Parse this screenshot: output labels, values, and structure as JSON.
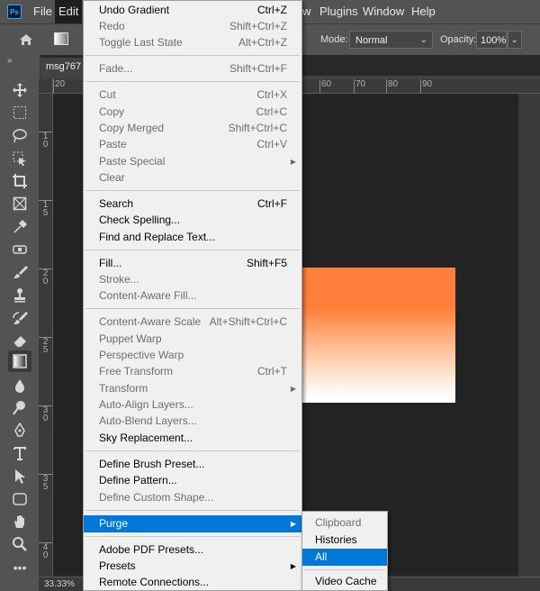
{
  "app": {
    "logo_text": "Ps"
  },
  "menubar": {
    "file": "File",
    "edit": "Edit",
    "view_partial": "w",
    "plugins": "Plugins",
    "window": "Window",
    "help": "Help"
  },
  "options": {
    "mode_label": "Mode:",
    "mode_value": "Normal",
    "opacity_label": "Opacity:",
    "opacity_value": "100%"
  },
  "document": {
    "tab_title": "msg767",
    "zoom": "33.33%",
    "ruler_h": [
      "20",
      "60",
      "70",
      "80",
      "90"
    ],
    "ruler_v": [
      "1",
      "0",
      "1",
      "5",
      "2",
      "0",
      "2",
      "5",
      "3",
      "0",
      "3",
      "5",
      "4",
      "0"
    ],
    "gradient_colors": {
      "top": "#ff7f3a",
      "bottom": "#ffffff"
    }
  },
  "edit_menu": {
    "undo": {
      "label": "Undo Gradient",
      "shortcut": "Ctrl+Z"
    },
    "redo": {
      "label": "Redo",
      "shortcut": "Shift+Ctrl+Z"
    },
    "toggle_last_state": {
      "label": "Toggle Last State",
      "shortcut": "Alt+Ctrl+Z"
    },
    "fade": {
      "label": "Fade...",
      "shortcut": "Shift+Ctrl+F"
    },
    "cut": {
      "label": "Cut",
      "shortcut": "Ctrl+X"
    },
    "copy": {
      "label": "Copy",
      "shortcut": "Ctrl+C"
    },
    "copy_merged": {
      "label": "Copy Merged",
      "shortcut": "Shift+Ctrl+C"
    },
    "paste": {
      "label": "Paste",
      "shortcut": "Ctrl+V"
    },
    "paste_special": {
      "label": "Paste Special"
    },
    "clear": {
      "label": "Clear"
    },
    "search": {
      "label": "Search",
      "shortcut": "Ctrl+F"
    },
    "check_spelling": {
      "label": "Check Spelling..."
    },
    "find_replace": {
      "label": "Find and Replace Text..."
    },
    "fill": {
      "label": "Fill...",
      "shortcut": "Shift+F5"
    },
    "stroke": {
      "label": "Stroke..."
    },
    "content_aware_fill": {
      "label": "Content-Aware Fill..."
    },
    "content_aware_scale": {
      "label": "Content-Aware Scale",
      "shortcut": "Alt+Shift+Ctrl+C"
    },
    "puppet_warp": {
      "label": "Puppet Warp"
    },
    "perspective_warp": {
      "label": "Perspective Warp"
    },
    "free_transform": {
      "label": "Free Transform",
      "shortcut": "Ctrl+T"
    },
    "transform": {
      "label": "Transform"
    },
    "auto_align": {
      "label": "Auto-Align Layers..."
    },
    "auto_blend": {
      "label": "Auto-Blend Layers..."
    },
    "sky_replacement": {
      "label": "Sky Replacement..."
    },
    "define_brush": {
      "label": "Define Brush Preset..."
    },
    "define_pattern": {
      "label": "Define Pattern..."
    },
    "define_custom_shape": {
      "label": "Define Custom Shape..."
    },
    "purge": {
      "label": "Purge"
    },
    "adobe_pdf_presets": {
      "label": "Adobe PDF Presets..."
    },
    "presets": {
      "label": "Presets"
    },
    "remote_connections": {
      "label": "Remote Connections..."
    }
  },
  "purge_submenu": {
    "clipboard": "Clipboard",
    "histories": "Histories",
    "all": "All",
    "video_cache": "Video Cache"
  }
}
